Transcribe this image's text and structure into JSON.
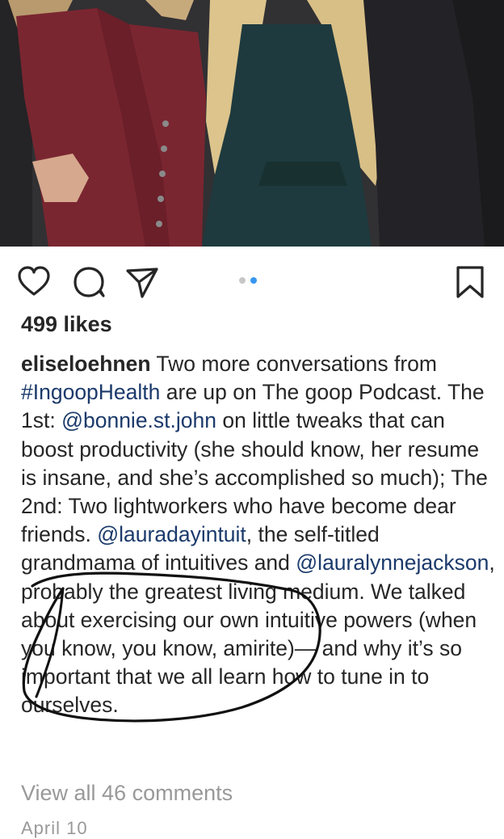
{
  "post": {
    "likes": "499 likes",
    "username": "eliseloehnen",
    "caption_1": " Two more conversations from ",
    "hashtag": "#IngoopHealth",
    "caption_2": " are up on The goop Podcast. The 1st: ",
    "mention_1": "@bonnie.st.john",
    "caption_3": " on little tweaks that can boost productivity (she should know, her resume is insane, and she’s accomplished so much); The 2nd: Two lightworkers who have become dear friends. ",
    "mention_2": "@lauradayintuit",
    "caption_4": ", the self-titled grandmama of intuitives and ",
    "mention_3": "@lauralynnejackson",
    "caption_5": ", probably the greatest living medium. We talked about exercising our own intuitive powers (when you know, you know, amirite)— and why it’s so important that we all learn how to tune in to ourselves.",
    "view_comments": "View all 46 comments",
    "date_partial": "April 10"
  },
  "carousel": {
    "count": 2,
    "active_index": 1
  },
  "icons": [
    "heart-icon",
    "comment-icon",
    "share-icon",
    "bookmark-icon"
  ],
  "colors": {
    "link": "#1b3a6b",
    "muted": "#999999",
    "dot_active": "#3897f0"
  }
}
